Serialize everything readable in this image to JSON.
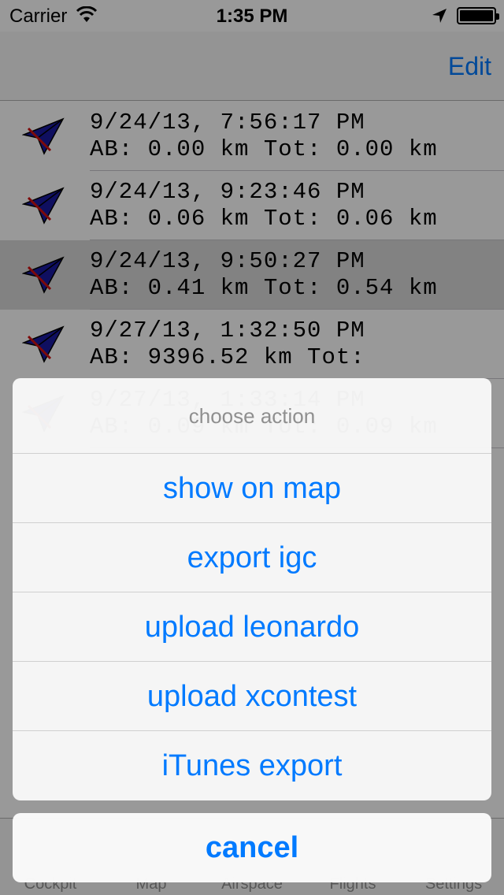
{
  "status_bar": {
    "carrier": "Carrier",
    "time": "1:35 PM"
  },
  "nav": {
    "edit_label": "Edit"
  },
  "flights": [
    {
      "line1": "9/24/13, 7:56:17 PM",
      "line2": "AB: 0.00 km Tot: 0.00 km",
      "selected": false
    },
    {
      "line1": "9/24/13, 9:23:46 PM",
      "line2": "AB: 0.06 km Tot: 0.06 km",
      "selected": false
    },
    {
      "line1": "9/24/13, 9:50:27 PM",
      "line2": "AB: 0.41 km Tot: 0.54 km",
      "selected": true
    },
    {
      "line1": "9/27/13, 1:32:50 PM",
      "line2": "AB: 9396.52 km Tot:",
      "selected": false
    },
    {
      "line1": "9/27/13, 1:33:14 PM",
      "line2": "AB: 0.09 km Tot: 0.09 km",
      "selected": false
    }
  ],
  "action_sheet": {
    "title": "choose action",
    "actions": [
      "show on map",
      "export igc",
      "upload leonardo",
      "upload xcontest",
      "iTunes export"
    ],
    "cancel_label": "cancel"
  },
  "tabs": [
    "Cockpit",
    "Map",
    "Airspace",
    "Flights",
    "Settings"
  ],
  "icons": {
    "row_icon": "paraglider-icon",
    "wifi": "wifi-icon",
    "location": "location-arrow-icon",
    "battery": "battery-icon"
  },
  "colors": {
    "accent": "#007aff",
    "icon_fill": "#1a1aa0",
    "icon_stripe": "#d01010"
  }
}
